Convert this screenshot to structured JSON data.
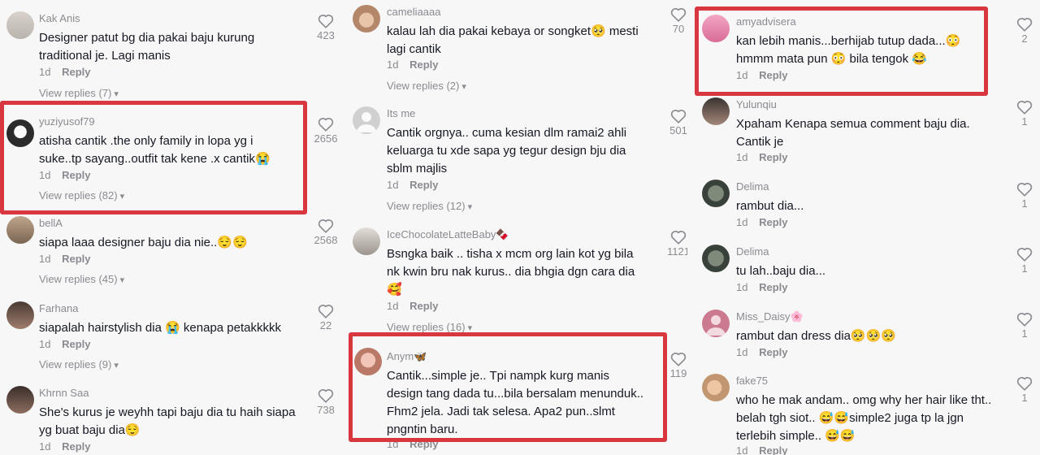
{
  "colors": {
    "highlight": "#d9373f",
    "muted": "#8a8b91",
    "text": "#161823"
  },
  "icons": {
    "like": "heart-outline-icon",
    "expand": "chevron-down-icon"
  },
  "columns": [
    {
      "comments": [
        {
          "username": "Kak Anis",
          "lines": [
            "Designer patut bg dia pakai baju kurung",
            "traditional je. Lagi manis"
          ],
          "time": "1d",
          "reply": "Reply",
          "view_replies": "View replies (7)",
          "likes": "423"
        },
        {
          "username": "yuziyusof79",
          "lines": [
            "atisha cantik .the only family in lopa yg i",
            "suke..tp sayang..outfit tak kene .x cantik😭"
          ],
          "time": "1d",
          "reply": "Reply",
          "view_replies": "View replies (82)",
          "likes": "2656"
        },
        {
          "username": "bellA",
          "lines": [
            "siapa laaa designer baju dia nie..😌😌"
          ],
          "time": "1d",
          "reply": "Reply",
          "view_replies": "View replies (45)",
          "likes": "2568"
        },
        {
          "username": "Farhana",
          "lines": [
            "siapalah hairstylish dia 😭 kenapa petakkkkk"
          ],
          "time": "1d",
          "reply": "Reply",
          "view_replies": "View replies (9)",
          "likes": "22"
        },
        {
          "username": "Khrnn Saa",
          "lines": [
            "She's kurus je weyhh tapi baju dia tu haih siapa",
            "yg buat baju dia😌"
          ],
          "time": "1d",
          "reply": "Reply",
          "view_replies": "",
          "likes": "738"
        }
      ]
    },
    {
      "comments": [
        {
          "username": "cameliaaaa",
          "lines": [
            "kalau lah dia pakai kebaya or songket🥺 mesti",
            "lagi cantik"
          ],
          "time": "1d",
          "reply": "Reply",
          "view_replies": "View replies (2)",
          "likes": "70"
        },
        {
          "username": "Its me",
          "lines": [
            "Cantik orgnya.. cuma kesian dlm ramai2 ahli",
            "keluarga tu xde sapa yg tegur design bju dia",
            "sblm majlis"
          ],
          "time": "1d",
          "reply": "Reply",
          "view_replies": "View replies (12)",
          "likes": "501"
        },
        {
          "username": "IceChocolateLatteBaby🍫",
          "lines": [
            "Bsngka baik .. tisha x mcm org lain kot yg bila",
            "nk kwin bru nak kurus.. dia bhgia dgn cara dia",
            "🥰"
          ],
          "time": "1d",
          "reply": "Reply",
          "view_replies": "View replies (16)",
          "likes": "1121"
        },
        {
          "username": "Anym🦋",
          "lines": [
            "Cantik...simple je.. Tpi nampk kurg manis",
            "design tang dada tu...bila bersalam menunduk..",
            "Fhm2 jela. Jadi tak selesa. Apa2 pun..slmt",
            "pngntin baru."
          ],
          "time": "1d",
          "reply": "Reply",
          "view_replies": "",
          "likes": "119"
        }
      ]
    },
    {
      "comments": [
        {
          "username": "amyadvisera",
          "lines": [
            "kan lebih manis...berhijab tutup dada...😳",
            "hmmm mata pun 😳 bila tengok 😂"
          ],
          "time": "1d",
          "reply": "Reply",
          "view_replies": "",
          "likes": "2"
        },
        {
          "username": "Yulunqiu",
          "lines": [
            "Xpaham Kenapa semua comment baju dia.",
            "Cantik je"
          ],
          "time": "1d",
          "reply": "Reply",
          "view_replies": "",
          "likes": "1"
        },
        {
          "username": "Delima",
          "lines": [
            "rambut dia..."
          ],
          "time": "1d",
          "reply": "Reply",
          "view_replies": "",
          "likes": "1"
        },
        {
          "username": "Delima",
          "lines": [
            "tu lah..baju dia..."
          ],
          "time": "1d",
          "reply": "Reply",
          "view_replies": "",
          "likes": "1"
        },
        {
          "username": "Miss_Daisy🌸",
          "lines": [
            "rambut dan dress dia🥺🥺🥺"
          ],
          "time": "1d",
          "reply": "Reply",
          "view_replies": "",
          "likes": "1"
        },
        {
          "username": "fake75",
          "lines": [
            "who he mak andam.. omg why her hair like tht..",
            "belah tgh siot.. 😅😅simple2 juga tp la jgn",
            "terlebih simple.. 😅😅"
          ],
          "time": "1d",
          "reply": "Reply",
          "view_replies": "",
          "likes": "1"
        }
      ]
    }
  ]
}
